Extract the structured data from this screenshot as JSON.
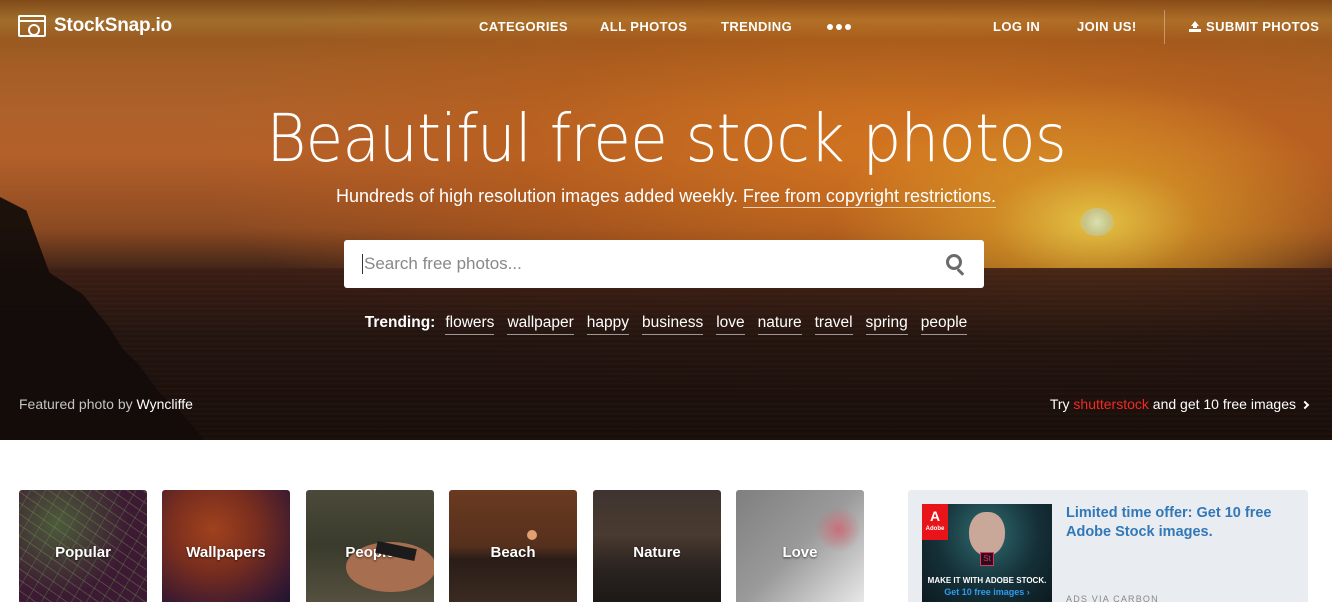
{
  "nav": {
    "logo_text": "StockSnap.io",
    "links": [
      "CATEGORIES",
      "ALL PHOTOS",
      "TRENDING"
    ],
    "more_icon": "ellipsis-icon",
    "login": "LOG IN",
    "join": "JOIN US!",
    "submit": "SUBMIT PHOTOS",
    "submit_icon": "upload-icon"
  },
  "hero": {
    "headline": "Beautiful free stock photos",
    "subline_text": "Hundreds of high resolution images added weekly.",
    "subline_link": "Free from copyright restrictions.",
    "search": {
      "placeholder": "Search free photos...",
      "value": "",
      "icon": "search-icon"
    },
    "trending_label": "Trending:",
    "trending_tags": [
      "flowers",
      "wallpaper",
      "happy",
      "business",
      "love",
      "nature",
      "travel",
      "spring",
      "people"
    ],
    "featured_prefix": "Featured photo by",
    "featured_author": "Wyncliffe",
    "promo": {
      "prefix": "Try",
      "brand": "shutterstock",
      "suffix": "and get 10 free images",
      "brand_color": "#ee2b24"
    }
  },
  "categories": [
    {
      "label": "Popular"
    },
    {
      "label": "Wallpapers"
    },
    {
      "label": "People"
    },
    {
      "label": "Beach"
    },
    {
      "label": "Nature"
    },
    {
      "label": "Love"
    }
  ],
  "ad": {
    "image_logo": "Adobe",
    "image_badge": "St",
    "image_caption": "MAKE IT WITH ADOBE STOCK.",
    "image_cta": "Get 10 free images ›",
    "text": "Limited time offer: Get 10 free Adobe Stock images.",
    "via": "ADS VIA CARBON",
    "text_color": "#3278b8"
  }
}
